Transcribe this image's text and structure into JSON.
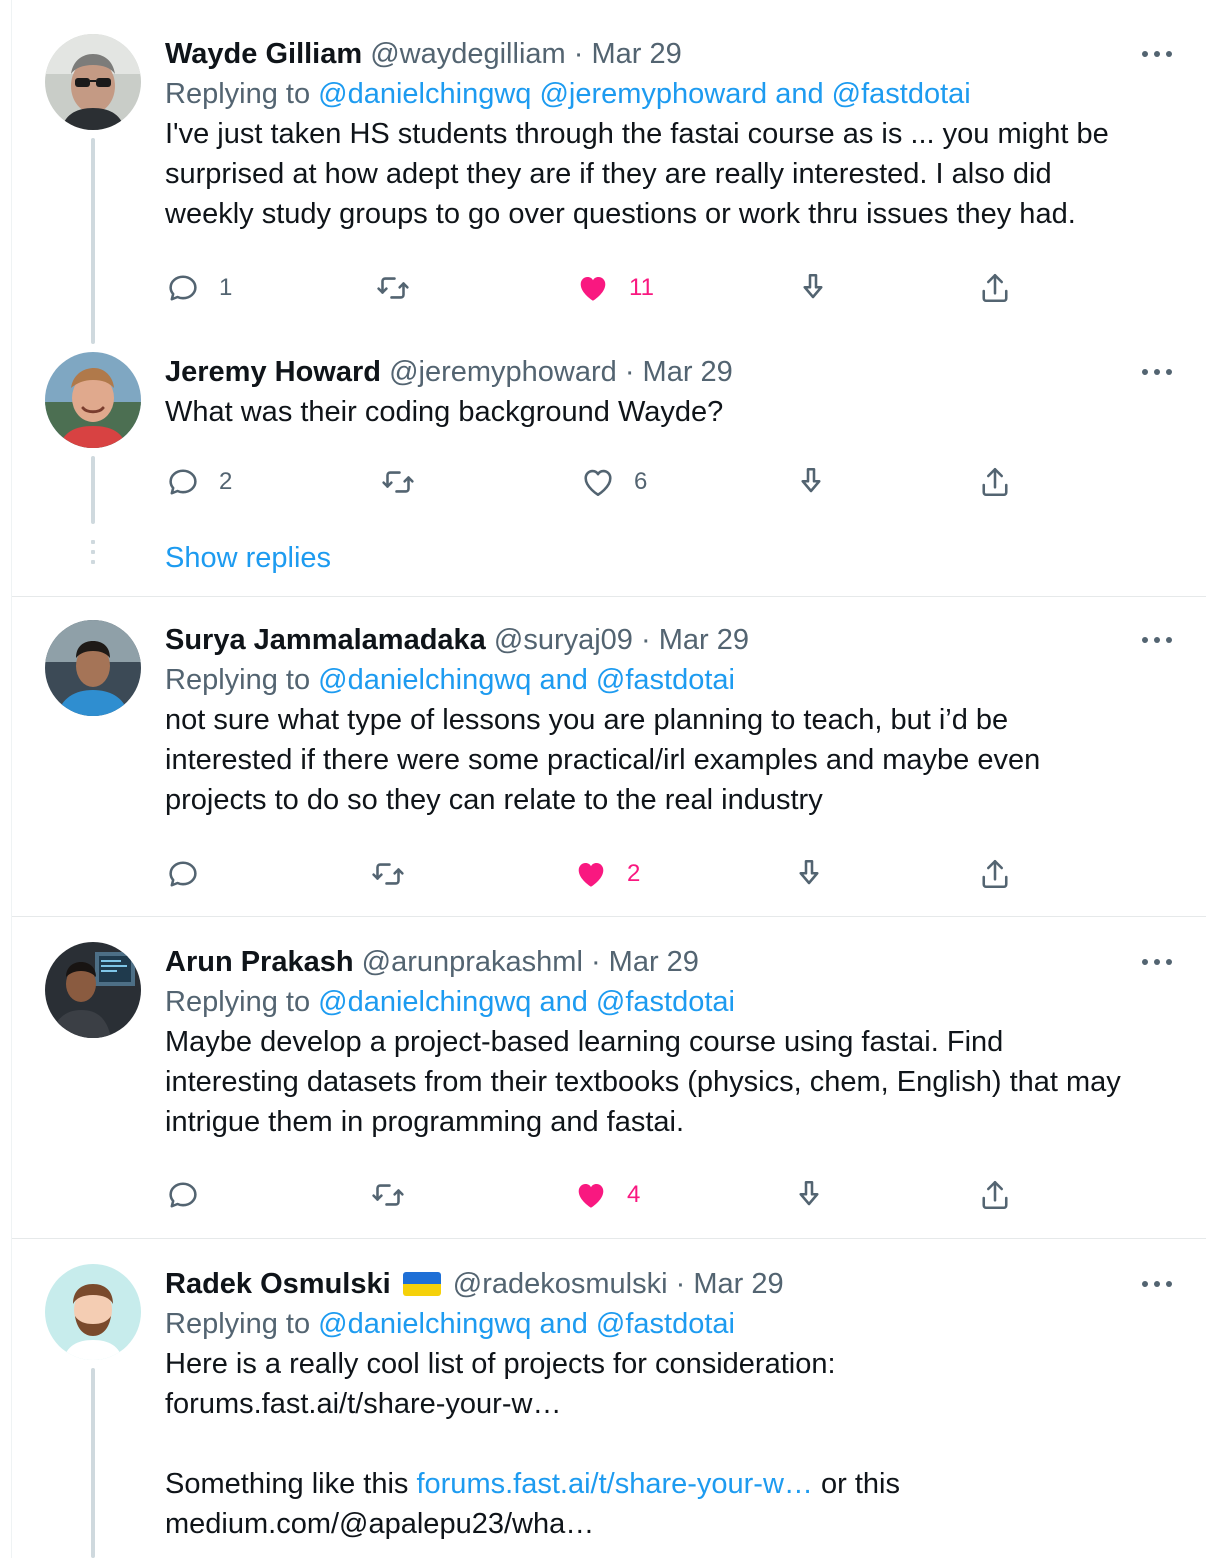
{
  "colors": {
    "link": "#1d9bf0",
    "like": "#f91880",
    "muted": "#536471",
    "text": "#0f1419"
  },
  "tweets": [
    {
      "name": "Wayde Gilliam",
      "handle": "@waydegilliam",
      "date": "· Mar 29",
      "replying_label": "Replying to",
      "replying_to": "@danielchingwq @jeremyphoward and @fastdotai",
      "lines": [
        "I've just taken HS students through the fastai course as is ... you might be",
        "surprised at how adept they are if they are really interested.  I also did",
        "weekly study groups to go over questions or work thru issues they had."
      ],
      "reply_count": "1",
      "retweet_count": "",
      "like_count": "11",
      "liked": true
    },
    {
      "name": "Jeremy Howard",
      "handle": "@jeremyphoward",
      "date": "· Mar 29",
      "lines": [
        "What was their coding background Wayde?"
      ],
      "reply_count": "2",
      "retweet_count": "",
      "like_count": "6",
      "liked": false,
      "show_replies": "Show replies"
    },
    {
      "name": "Surya Jammalamadaka",
      "handle": "@suryaj09",
      "date": "· Mar 29",
      "replying_label": "Replying to",
      "replying_to": "@danielchingwq and @fastdotai",
      "lines": [
        "not sure what type of lessons you are planning to teach, but i’d be",
        "interested if there were some practical/irl examples and maybe even",
        "projects to do so they can relate to the real industry"
      ],
      "reply_count": "",
      "retweet_count": "",
      "like_count": "2",
      "liked": true
    },
    {
      "name": "Arun Prakash",
      "handle": "@arunprakashml",
      "date": "· Mar 29",
      "replying_label": "Replying to",
      "replying_to": "@danielchingwq and @fastdotai",
      "lines": [
        "Maybe develop a project-based learning course using fastai. Find",
        "interesting datasets from their textbooks (physics, chem, English) that may",
        "intrigue them in programming and fastai."
      ],
      "reply_count": "",
      "retweet_count": "",
      "like_count": "4",
      "liked": true
    },
    {
      "name": "Radek Osmulski",
      "handle": "@radekosmulski",
      "date": "· Mar 29",
      "replying_label": "Replying to",
      "replying_to": "@danielchingwq and @fastdotai",
      "line1": "Here is a really cool list of projects for consideration:",
      "link1": "forums.fast.ai/t/share-your-w…",
      "line3_prefix": "Something like this ",
      "link2": "forums.fast.ai/t/share-your-w…",
      "line3_suffix": " or this",
      "link3": "medium.com/@apalepu23/wha…"
    }
  ],
  "icons": {
    "reply": "speech-bubble-icon",
    "retweet": "retweet-icon",
    "like": "heart-icon",
    "bookmark": "download-arrow-icon",
    "share": "share-upload-icon",
    "more": "more-dots-icon",
    "flag": "ukraine-flag-icon"
  }
}
